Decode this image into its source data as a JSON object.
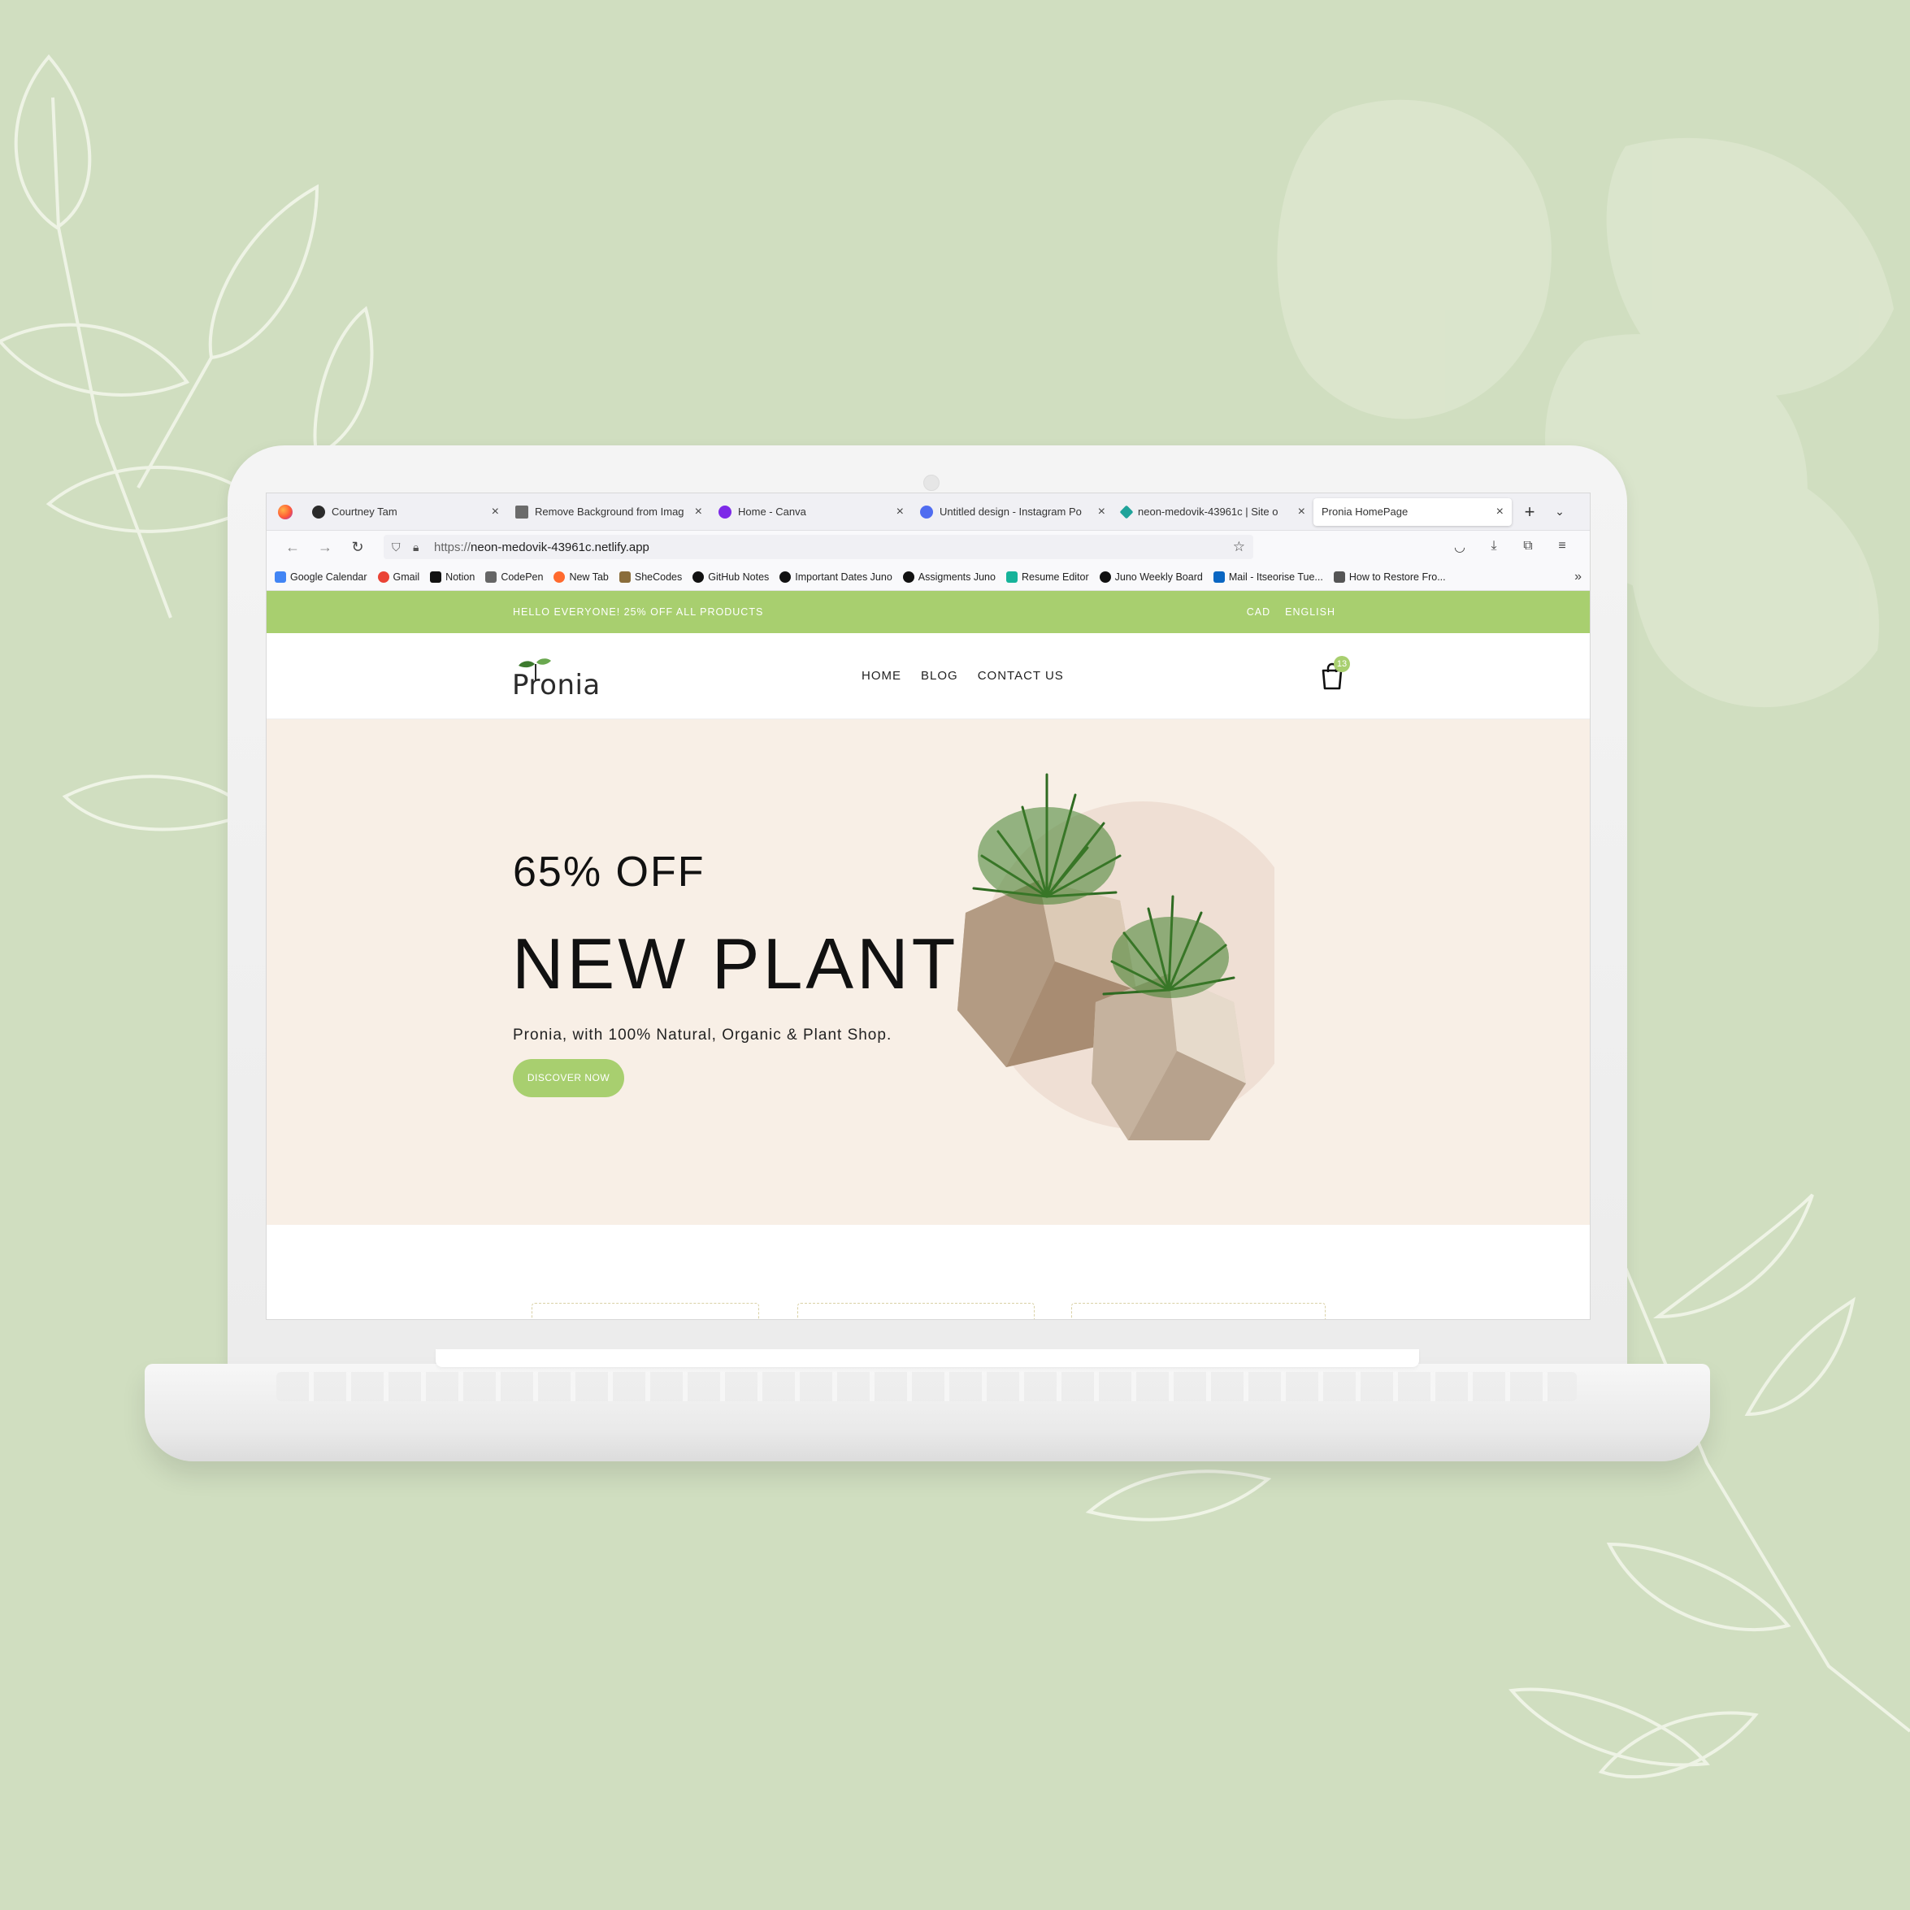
{
  "browser": {
    "tabs": [
      {
        "label": "Courtney Tam",
        "favicon": "courtney-favicon-icon",
        "color": "#2b2b2b"
      },
      {
        "label": "Remove Background from Imag",
        "favicon": "remove-bg-favicon-icon",
        "color": "#555555"
      },
      {
        "label": "Home - Canva",
        "favicon": "canva-favicon-icon",
        "color": "#7d2ae8"
      },
      {
        "label": "Untitled design - Instagram Po",
        "favicon": "canva-favicon-icon",
        "color": "#4f6cf0"
      },
      {
        "label": "neon-medovik-43961c | Site o",
        "favicon": "netlify-favicon-icon",
        "color": "#1fa39a"
      },
      {
        "label": "Pronia HomePage",
        "favicon": "",
        "color": ""
      }
    ],
    "url_prefix": "https://",
    "url": "neon-medovik-43961c.netlify.app",
    "bookmarks": [
      {
        "label": "Google Calendar",
        "icon": "google-calendar-icon",
        "color": "#4285f4"
      },
      {
        "label": "Gmail",
        "icon": "google-icon",
        "color": "#ea4335"
      },
      {
        "label": "Notion",
        "icon": "notion-icon",
        "color": "#111111"
      },
      {
        "label": "CodePen",
        "icon": "codepen-icon",
        "color": "#666666"
      },
      {
        "label": "New Tab",
        "icon": "firefox-icon",
        "color": "#ff6a2e"
      },
      {
        "label": "SheCodes",
        "icon": "shecodes-icon",
        "color": "#8a6d3b"
      },
      {
        "label": "GitHub Notes",
        "icon": "github-icon",
        "color": "#111111"
      },
      {
        "label": "Important Dates Juno",
        "icon": "github-icon",
        "color": "#111111"
      },
      {
        "label": "Assigments Juno",
        "icon": "github-icon",
        "color": "#111111"
      },
      {
        "label": "Resume Editor",
        "icon": "resume-editor-icon",
        "color": "#16b39a"
      },
      {
        "label": "Juno Weekly Board",
        "icon": "github-icon",
        "color": "#111111"
      },
      {
        "label": "Mail - Itseorise Tue...",
        "icon": "outlook-icon",
        "color": "#0a66c2"
      },
      {
        "label": "How to Restore Fro...",
        "icon": "home-icon",
        "color": "#555555"
      }
    ]
  },
  "site": {
    "announcement": "HELLO EVERYONE! 25% OFF ALL PRODUCTS",
    "currency": "CAD",
    "language": "ENGLISH",
    "logo_text": "Pronia",
    "menu": [
      "HOME",
      "BLOG",
      "CONTACT US"
    ],
    "cart_count": "13",
    "accent": "#a8cf6f",
    "hero": {
      "offer": "65% OFF",
      "title": "NEW PLANT",
      "subtitle": "Pronia, with 100% Natural, Organic & Plant Shop.",
      "button": "DISCOVER NOW",
      "background": "#f8efe6"
    }
  }
}
